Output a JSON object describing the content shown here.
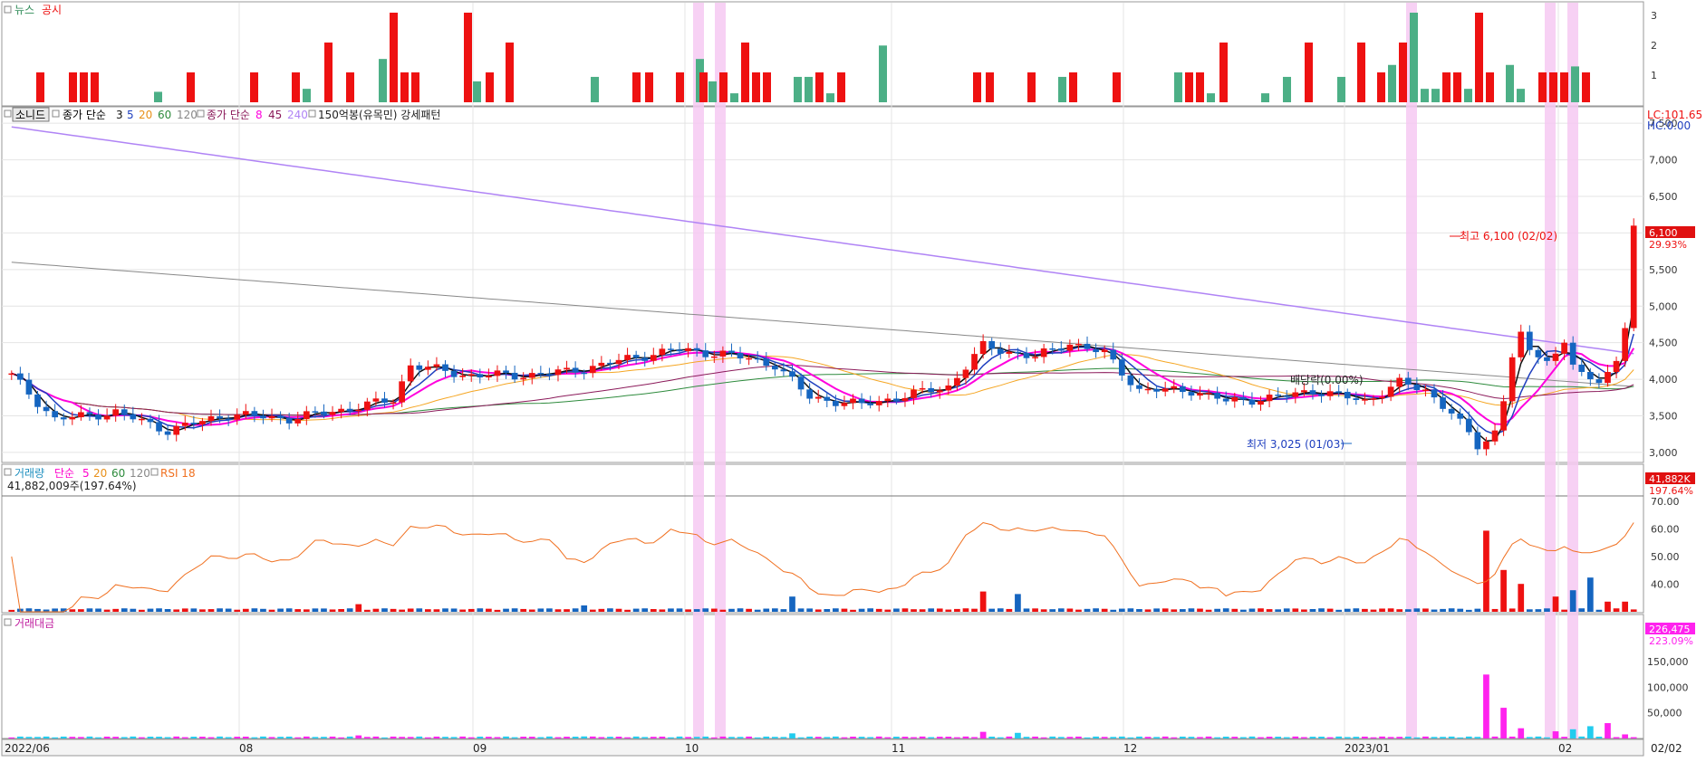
{
  "colors": {
    "up": "#ee1111",
    "down": "#1565c0",
    "news": "#4caf86",
    "disclosure": "#ee1111",
    "highlight": "#f6c9f2",
    "ma3": "#111111",
    "ma5": "#1f3fbf",
    "ma20": "#f5a623",
    "ma60": "#2e8b3d",
    "ma120": "#888888",
    "ma8": "#ff00dd",
    "ma45": "#8b1a5a",
    "ma240": "#b084f5",
    "rsi": "#f07020",
    "vol_ma5": "#ff00cc",
    "vol_ma20": "#f5a623",
    "vol_ma60": "#2e8b3d",
    "amount": "#ff22ee",
    "amount_down": "#22ccee"
  },
  "labels": {
    "news_legend": "뉴스",
    "disc_legend": "공시",
    "price_tab": "소니드",
    "ma_group1_title": "종가 단순",
    "ma_group1_periods": [
      "3",
      "5",
      "20",
      "60",
      "120"
    ],
    "ma_group2_title": "종가 단순",
    "ma_group2_periods": [
      "8",
      "45",
      "240"
    ],
    "pattern_label": "150억봉(유목민) 강세패턴",
    "lc_text": "LC:101.65",
    "hc_text": "HC:0.00",
    "high_annotation": "최고 6,100 (02/02)",
    "low_annotation": "최저 3,025 (01/03)",
    "dividend_annotation": "배당락(0.00%)",
    "last_price_tag": "6,100",
    "last_price_pct": "29.93%",
    "volume_title": "거래량",
    "volume_ma_title": "단순",
    "volume_ma_periods": [
      "5",
      "20",
      "60",
      "120"
    ],
    "rsi_title": "RSI 18",
    "volume_info": "41,882,009주(197.64%)",
    "volume_tag": "41,882K",
    "volume_pct": "197.64%",
    "amount_title": "거래대금",
    "amount_tag": "226,475",
    "amount_pct": "223.09%"
  },
  "axes": {
    "news_ticks": [
      "3",
      "2",
      "1"
    ],
    "price_ticks": [
      "7,500",
      "7,000",
      "6,500",
      "6,000",
      "5,500",
      "5,000",
      "4,500",
      "4,000",
      "3,500",
      "3,000"
    ],
    "rsi_ticks": [
      "70.00",
      "60.00",
      "50.00",
      "40.00"
    ],
    "amount_ticks": [
      "150,000",
      "100,000",
      "50,000"
    ],
    "x_labels": [
      "2022/06",
      "08",
      "09",
      "10",
      "11",
      "12",
      "2023/01",
      "02",
      "02/02"
    ]
  },
  "chart_data": [
    {
      "type": "bar",
      "title": "뉴스 / 공시",
      "series": [
        {
          "name": "뉴스",
          "values": [
            0,
            0,
            0,
            0,
            0,
            0,
            0,
            0,
            0,
            0,
            0,
            0,
            0,
            0,
            0,
            0,
            0,
            0,
            0,
            0,
            0,
            0,
            0,
            0,
            0,
            0,
            0,
            0,
            0,
            0,
            0,
            0,
            0,
            0,
            0,
            0,
            0,
            0,
            0,
            0,
            0,
            0,
            0,
            0,
            0,
            0,
            0,
            0,
            0,
            0,
            0,
            0,
            0,
            0,
            0,
            0,
            0,
            0,
            0,
            0,
            0,
            0,
            0,
            0,
            0,
            0,
            0,
            0,
            0,
            0,
            0,
            0,
            0,
            0,
            0,
            0,
            0,
            0,
            0,
            0,
            0,
            0,
            0,
            0,
            0,
            0,
            0,
            0,
            0,
            0,
            0,
            0,
            0,
            0,
            0,
            0,
            0,
            0,
            0,
            0,
            0,
            0,
            0,
            0,
            0,
            0,
            0,
            0,
            0,
            0,
            0,
            0,
            0,
            0,
            0,
            0,
            0,
            0,
            0,
            0,
            0,
            0,
            0,
            0,
            0,
            0,
            0,
            0,
            0,
            0,
            0,
            0,
            0,
            0,
            0,
            0,
            0,
            0,
            0,
            0,
            0,
            0,
            0,
            0,
            0,
            0,
            0,
            0,
            0,
            0,
            0,
            0,
            0,
            0,
            0,
            0,
            0,
            0,
            0,
            0,
            0,
            0,
            0,
            0,
            0,
            0,
            0,
            0,
            0,
            0,
            0,
            0,
            0,
            0,
            0,
            0,
            0,
            0,
            0,
            0,
            0,
            0,
            0,
            0,
            0,
            0,
            0,
            0,
            0,
            0,
            0,
            0,
            0,
            0,
            0,
            0,
            0,
            0,
            0,
            0,
            0,
            0,
            0,
            0,
            0,
            0,
            0,
            0,
            0,
            0,
            0,
            0,
            0,
            0,
            0,
            0,
            0,
            0,
            0,
            0,
            0,
            0,
            0,
            0,
            0,
            0,
            0,
            0,
            0,
            0,
            0,
            0,
            0,
            0,
            0,
            0,
            0,
            0,
            0,
            0,
            0,
            0,
            0,
            0,
            0,
            0,
            0,
            0,
            0,
            0,
            0,
            0,
            0,
            0,
            0,
            0,
            0,
            0,
            0,
            0,
            0,
            0,
            0,
            0,
            0,
            0,
            0,
            0,
            0,
            0,
            0,
            0,
            0,
            0,
            0,
            0,
            0,
            0,
            0
          ]
        },
        {
          "name": "공시",
          "values": [
            0
          ]
        }
      ]
    },
    {
      "type": "candlestick",
      "title": "소니드",
      "ylim": [
        2900,
        7700
      ],
      "high": {
        "value": 6100,
        "date": "02/02"
      },
      "low": {
        "value": 3025,
        "date": "01/03"
      },
      "last_close": 6100,
      "last_change_pct": 29.93
    },
    {
      "type": "bar",
      "title": "거래량",
      "last_volume": 41882009,
      "last_volume_pct": 197.64,
      "rsi_period": 18
    },
    {
      "type": "bar",
      "title": "거래대금",
      "ylim": [
        0,
        230000
      ],
      "last_amount": 226475,
      "last_amount_pct": 223.09
    }
  ]
}
